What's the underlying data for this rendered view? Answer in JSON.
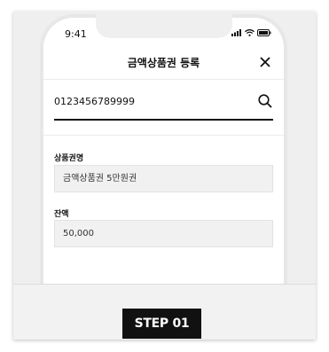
{
  "status_bar": {
    "time": "9:41",
    "icons": [
      "signal-icon",
      "wifi-icon",
      "battery-icon"
    ]
  },
  "header": {
    "title": "금액상품권 등록",
    "close_icon": "close-icon"
  },
  "search": {
    "value": "0123456789999",
    "icon": "search-icon"
  },
  "fields": [
    {
      "label": "상품권명",
      "value": "금액상품권 5만원권"
    },
    {
      "label": "잔액",
      "value": "50,000"
    }
  ],
  "step_badge": "STEP 01",
  "colors": {
    "badge_bg": "#111111",
    "badge_text": "#ffffff",
    "field_bg": "#f1f1f1",
    "card_bg": "#efefef"
  }
}
